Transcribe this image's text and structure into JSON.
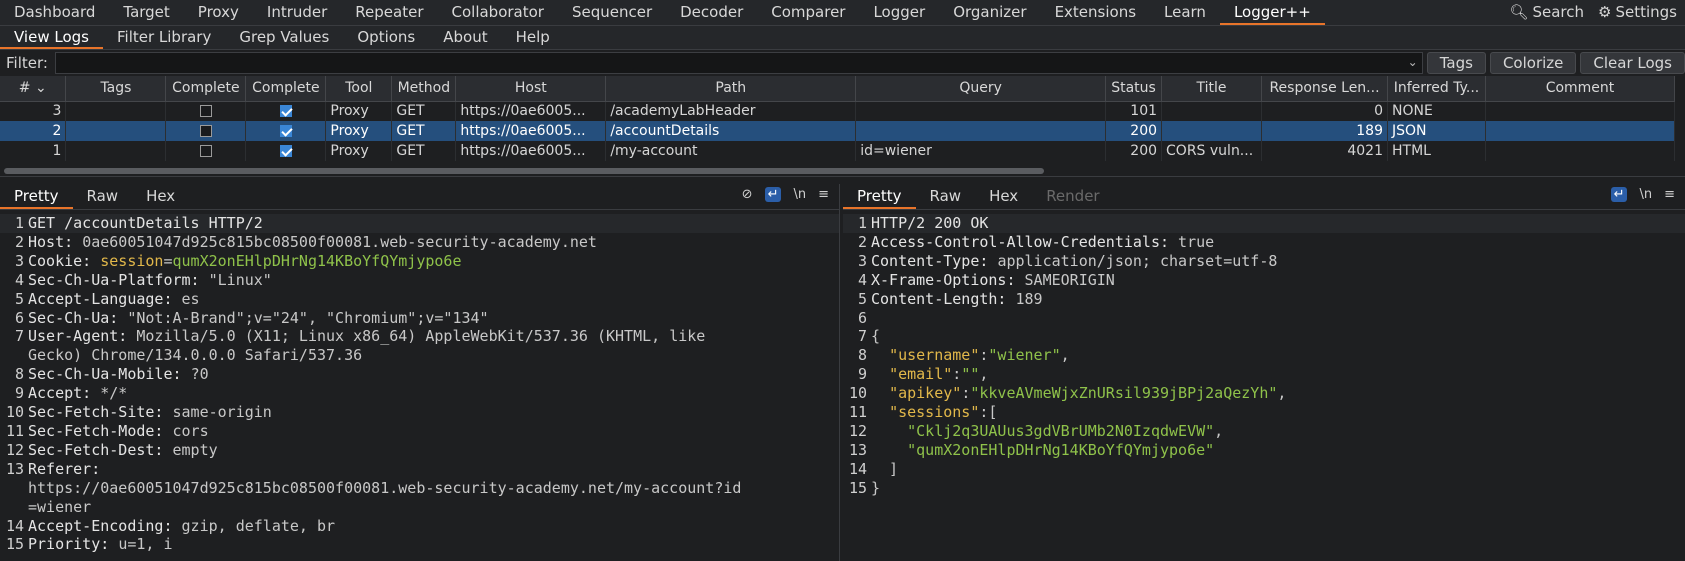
{
  "topnav": {
    "tabs": [
      "Dashboard",
      "Target",
      "Proxy",
      "Intruder",
      "Repeater",
      "Collaborator",
      "Sequencer",
      "Decoder",
      "Comparer",
      "Logger",
      "Organizer",
      "Extensions",
      "Learn",
      "Logger++"
    ],
    "active": "Logger++",
    "search": "Search",
    "settings": "Settings"
  },
  "subnav": {
    "tabs": [
      "View Logs",
      "Filter Library",
      "Grep Values",
      "Options",
      "About",
      "Help"
    ],
    "active": "View Logs"
  },
  "filter": {
    "label": "Filter:",
    "value": "",
    "buttons": [
      "Tags",
      "Colorize",
      "Clear Logs"
    ]
  },
  "table": {
    "headers": [
      "# ⌄",
      "Tags",
      "Complete",
      "Complete",
      "Tool",
      "Method",
      "Host",
      "Path",
      "Query",
      "Status",
      "Title",
      "Response Len...",
      "Inferred Ty...",
      "Comment"
    ],
    "rows": [
      {
        "num": "3",
        "tags": "",
        "c1": false,
        "c2": true,
        "tool": "Proxy",
        "method": "GET",
        "host": "https://0ae6005...",
        "path": "/academyLabHeader",
        "query": "",
        "status": "101",
        "title": "",
        "len": "0",
        "type": "NONE",
        "comment": ""
      },
      {
        "num": "2",
        "tags": "",
        "c1": false,
        "c2": true,
        "tool": "Proxy",
        "method": "GET",
        "host": "https://0ae6005...",
        "path": "/accountDetails",
        "query": "",
        "status": "200",
        "title": "",
        "len": "189",
        "type": "JSON",
        "comment": "",
        "selected": true
      },
      {
        "num": "1",
        "tags": "",
        "c1": false,
        "c2": true,
        "tool": "Proxy",
        "method": "GET",
        "host": "https://0ae6005...",
        "path": "/my-account",
        "query": "id=wiener",
        "status": "200",
        "title": "CORS vuln...",
        "len": "4021",
        "type": "HTML",
        "comment": ""
      }
    ]
  },
  "request": {
    "tabs": [
      "Pretty",
      "Raw",
      "Hex"
    ],
    "active": "Pretty",
    "icons": [
      "eye-off-icon",
      "wrap-icon",
      "newline-icon",
      "menu-icon"
    ],
    "lines": [
      {
        "n": "1",
        "parts": [
          {
            "c": "k",
            "t": "GET /accountDetails HTTP/2"
          }
        ]
      },
      {
        "n": "2",
        "parts": [
          {
            "c": "k",
            "t": "Host: "
          },
          {
            "c": "v",
            "t": "0ae60051047d925c815bc08500f00081.web-security-academy.net"
          }
        ]
      },
      {
        "n": "3",
        "parts": [
          {
            "c": "k",
            "t": "Cookie: "
          },
          {
            "c": "y",
            "t": "session"
          },
          {
            "c": "v",
            "t": "="
          },
          {
            "c": "g",
            "t": "qumX2onEHlpDHrNg14KBoYfQYmjypo6e"
          }
        ]
      },
      {
        "n": "4",
        "parts": [
          {
            "c": "k",
            "t": "Sec-Ch-Ua-Platform: "
          },
          {
            "c": "v",
            "t": "\"Linux\""
          }
        ]
      },
      {
        "n": "5",
        "parts": [
          {
            "c": "k",
            "t": "Accept-Language: "
          },
          {
            "c": "v",
            "t": "es"
          }
        ]
      },
      {
        "n": "6",
        "parts": [
          {
            "c": "k",
            "t": "Sec-Ch-Ua: "
          },
          {
            "c": "v",
            "t": "\"Not:A-Brand\";v=\"24\", \"Chromium\";v=\"134\""
          }
        ]
      },
      {
        "n": "7",
        "parts": [
          {
            "c": "k",
            "t": "User-Agent: "
          },
          {
            "c": "v",
            "t": "Mozilla/5.0 (X11; Linux x86_64) AppleWebKit/537.36 (KHTML, like"
          }
        ]
      },
      {
        "n": "",
        "parts": [
          {
            "c": "v",
            "t": "Gecko) Chrome/134.0.0.0 Safari/537.36"
          }
        ]
      },
      {
        "n": "8",
        "parts": [
          {
            "c": "k",
            "t": "Sec-Ch-Ua-Mobile: "
          },
          {
            "c": "v",
            "t": "?0"
          }
        ]
      },
      {
        "n": "9",
        "parts": [
          {
            "c": "k",
            "t": "Accept: "
          },
          {
            "c": "v",
            "t": "*/*"
          }
        ]
      },
      {
        "n": "10",
        "parts": [
          {
            "c": "k",
            "t": "Sec-Fetch-Site: "
          },
          {
            "c": "v",
            "t": "same-origin"
          }
        ]
      },
      {
        "n": "11",
        "parts": [
          {
            "c": "k",
            "t": "Sec-Fetch-Mode: "
          },
          {
            "c": "v",
            "t": "cors"
          }
        ]
      },
      {
        "n": "12",
        "parts": [
          {
            "c": "k",
            "t": "Sec-Fetch-Dest: "
          },
          {
            "c": "v",
            "t": "empty"
          }
        ]
      },
      {
        "n": "13",
        "parts": [
          {
            "c": "k",
            "t": "Referer:"
          }
        ]
      },
      {
        "n": "",
        "parts": [
          {
            "c": "v",
            "t": "https://0ae60051047d925c815bc08500f00081.web-security-academy.net/my-account?id"
          }
        ]
      },
      {
        "n": "",
        "parts": [
          {
            "c": "v",
            "t": "=wiener"
          }
        ]
      },
      {
        "n": "14",
        "parts": [
          {
            "c": "k",
            "t": "Accept-Encoding: "
          },
          {
            "c": "v",
            "t": "gzip, deflate, br"
          }
        ]
      },
      {
        "n": "15",
        "parts": [
          {
            "c": "k",
            "t": "Priority: "
          },
          {
            "c": "v",
            "t": "u=1, i"
          }
        ]
      }
    ]
  },
  "response": {
    "tabs": [
      "Pretty",
      "Raw",
      "Hex",
      "Render"
    ],
    "active": "Pretty",
    "disabled": "Render",
    "icons": [
      "wrap-icon",
      "newline-icon",
      "menu-icon"
    ],
    "lines": [
      {
        "n": "1",
        "parts": [
          {
            "c": "k",
            "t": "HTTP/2 200 OK"
          }
        ]
      },
      {
        "n": "2",
        "parts": [
          {
            "c": "k",
            "t": "Access-Control-Allow-Credentials: "
          },
          {
            "c": "v",
            "t": "true"
          }
        ]
      },
      {
        "n": "3",
        "parts": [
          {
            "c": "k",
            "t": "Content-Type: "
          },
          {
            "c": "v",
            "t": "application/json; charset=utf-8"
          }
        ]
      },
      {
        "n": "4",
        "parts": [
          {
            "c": "k",
            "t": "X-Frame-Options: "
          },
          {
            "c": "v",
            "t": "SAMEORIGIN"
          }
        ]
      },
      {
        "n": "5",
        "parts": [
          {
            "c": "k",
            "t": "Content-Length: "
          },
          {
            "c": "v",
            "t": "189"
          }
        ]
      },
      {
        "n": "6",
        "parts": [
          {
            "c": "v",
            "t": ""
          }
        ]
      },
      {
        "n": "7",
        "parts": [
          {
            "c": "v",
            "t": "{"
          }
        ]
      },
      {
        "n": "8",
        "parts": [
          {
            "c": "v",
            "t": "  "
          },
          {
            "c": "y",
            "t": "\"username\""
          },
          {
            "c": "v",
            "t": ":"
          },
          {
            "c": "g",
            "t": "\"wiener\""
          },
          {
            "c": "v",
            "t": ","
          }
        ]
      },
      {
        "n": "9",
        "parts": [
          {
            "c": "v",
            "t": "  "
          },
          {
            "c": "y",
            "t": "\"email\""
          },
          {
            "c": "v",
            "t": ":"
          },
          {
            "c": "g",
            "t": "\"\""
          },
          {
            "c": "v",
            "t": ","
          }
        ]
      },
      {
        "n": "10",
        "parts": [
          {
            "c": "v",
            "t": "  "
          },
          {
            "c": "y",
            "t": "\"apikey\""
          },
          {
            "c": "v",
            "t": ":"
          },
          {
            "c": "g",
            "t": "\"kkveAVmeWjxZnURsil939jBPj2aQezYh\""
          },
          {
            "c": "v",
            "t": ","
          }
        ]
      },
      {
        "n": "11",
        "parts": [
          {
            "c": "v",
            "t": "  "
          },
          {
            "c": "y",
            "t": "\"sessions\""
          },
          {
            "c": "v",
            "t": ":["
          }
        ]
      },
      {
        "n": "12",
        "parts": [
          {
            "c": "v",
            "t": "    "
          },
          {
            "c": "g",
            "t": "\"Cklj2q3UAUus3gdVBrUMb2N0IzqdwEVW\""
          },
          {
            "c": "v",
            "t": ","
          }
        ]
      },
      {
        "n": "13",
        "parts": [
          {
            "c": "v",
            "t": "    "
          },
          {
            "c": "g",
            "t": "\"qumX2onEHlpDHrNg14KBoYfQYmjypo6e\""
          }
        ]
      },
      {
        "n": "14",
        "parts": [
          {
            "c": "v",
            "t": "  ]"
          }
        ]
      },
      {
        "n": "15",
        "parts": [
          {
            "c": "v",
            "t": "}"
          }
        ]
      }
    ]
  }
}
